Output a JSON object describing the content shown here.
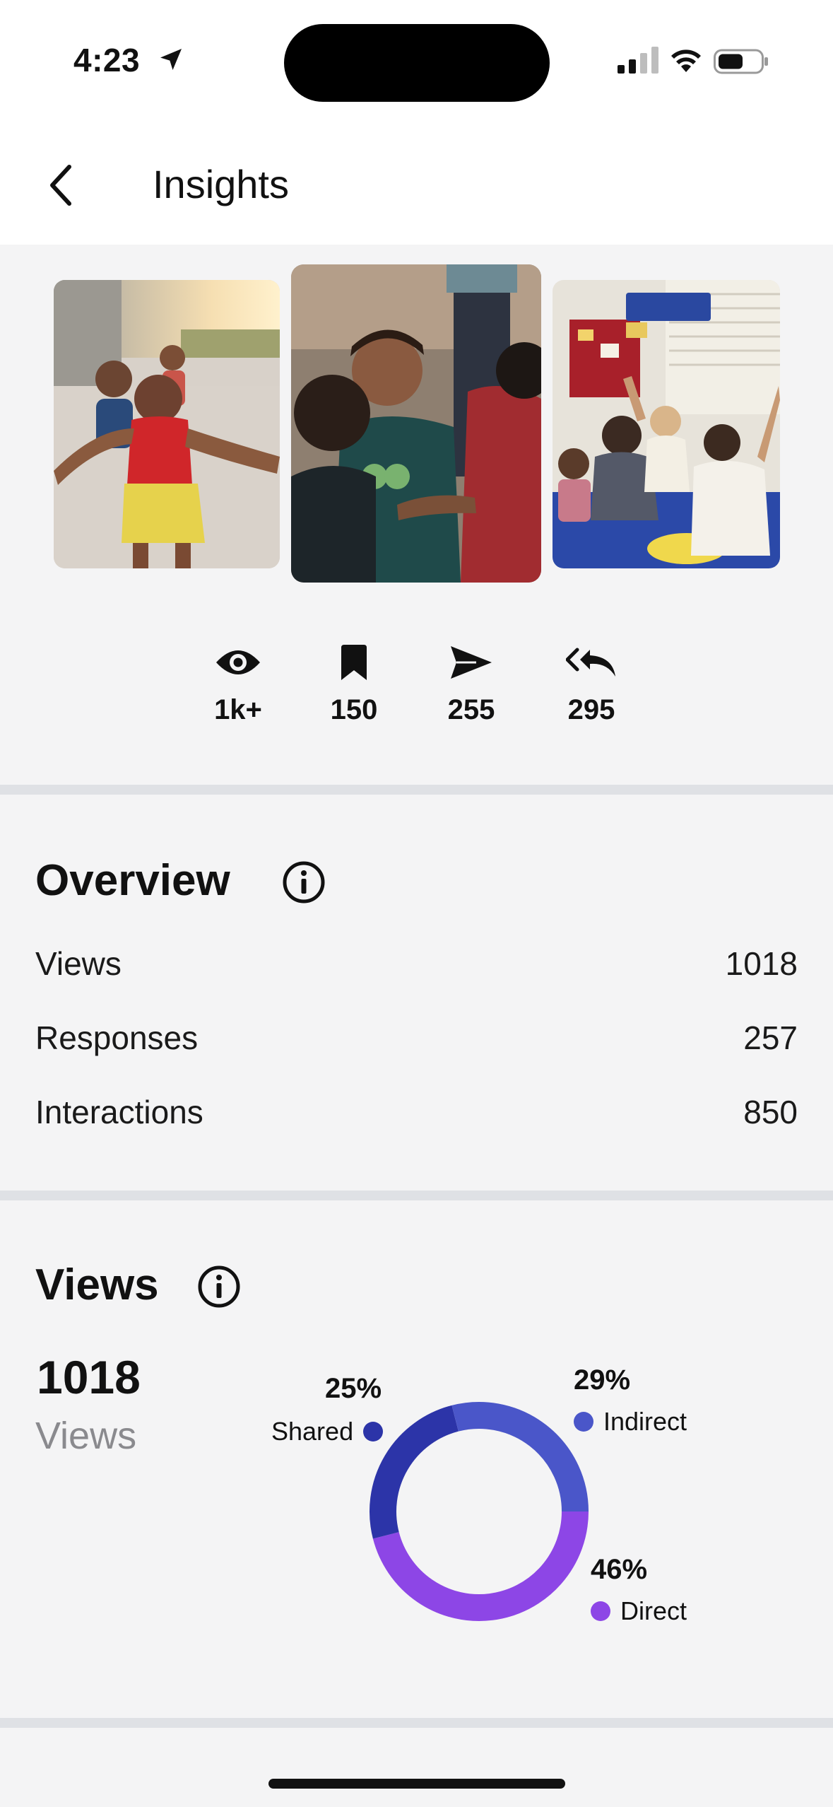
{
  "status_bar": {
    "time": "4:23"
  },
  "nav": {
    "title": "Insights"
  },
  "stats": [
    {
      "icon": "eye-icon",
      "value": "1k+"
    },
    {
      "icon": "bookmark-icon",
      "value": "150"
    },
    {
      "icon": "send-icon",
      "value": "255"
    },
    {
      "icon": "reply-all-icon",
      "value": "295"
    }
  ],
  "overview": {
    "title": "Overview",
    "rows": [
      {
        "label": "Views",
        "value": "1018"
      },
      {
        "label": "Responses",
        "value": "257"
      },
      {
        "label": "Interactions",
        "value": "850"
      }
    ]
  },
  "views": {
    "title": "Views",
    "total": "1018",
    "total_label": "Views"
  },
  "chart_data": {
    "type": "pie",
    "categories": [
      "Shared",
      "Indirect",
      "Direct"
    ],
    "values": [
      25,
      29,
      46
    ],
    "labels": [
      "25%",
      "29%",
      "46%"
    ],
    "colors": [
      "#2c34a8",
      "#4a56c9",
      "#8d46e6"
    ]
  }
}
